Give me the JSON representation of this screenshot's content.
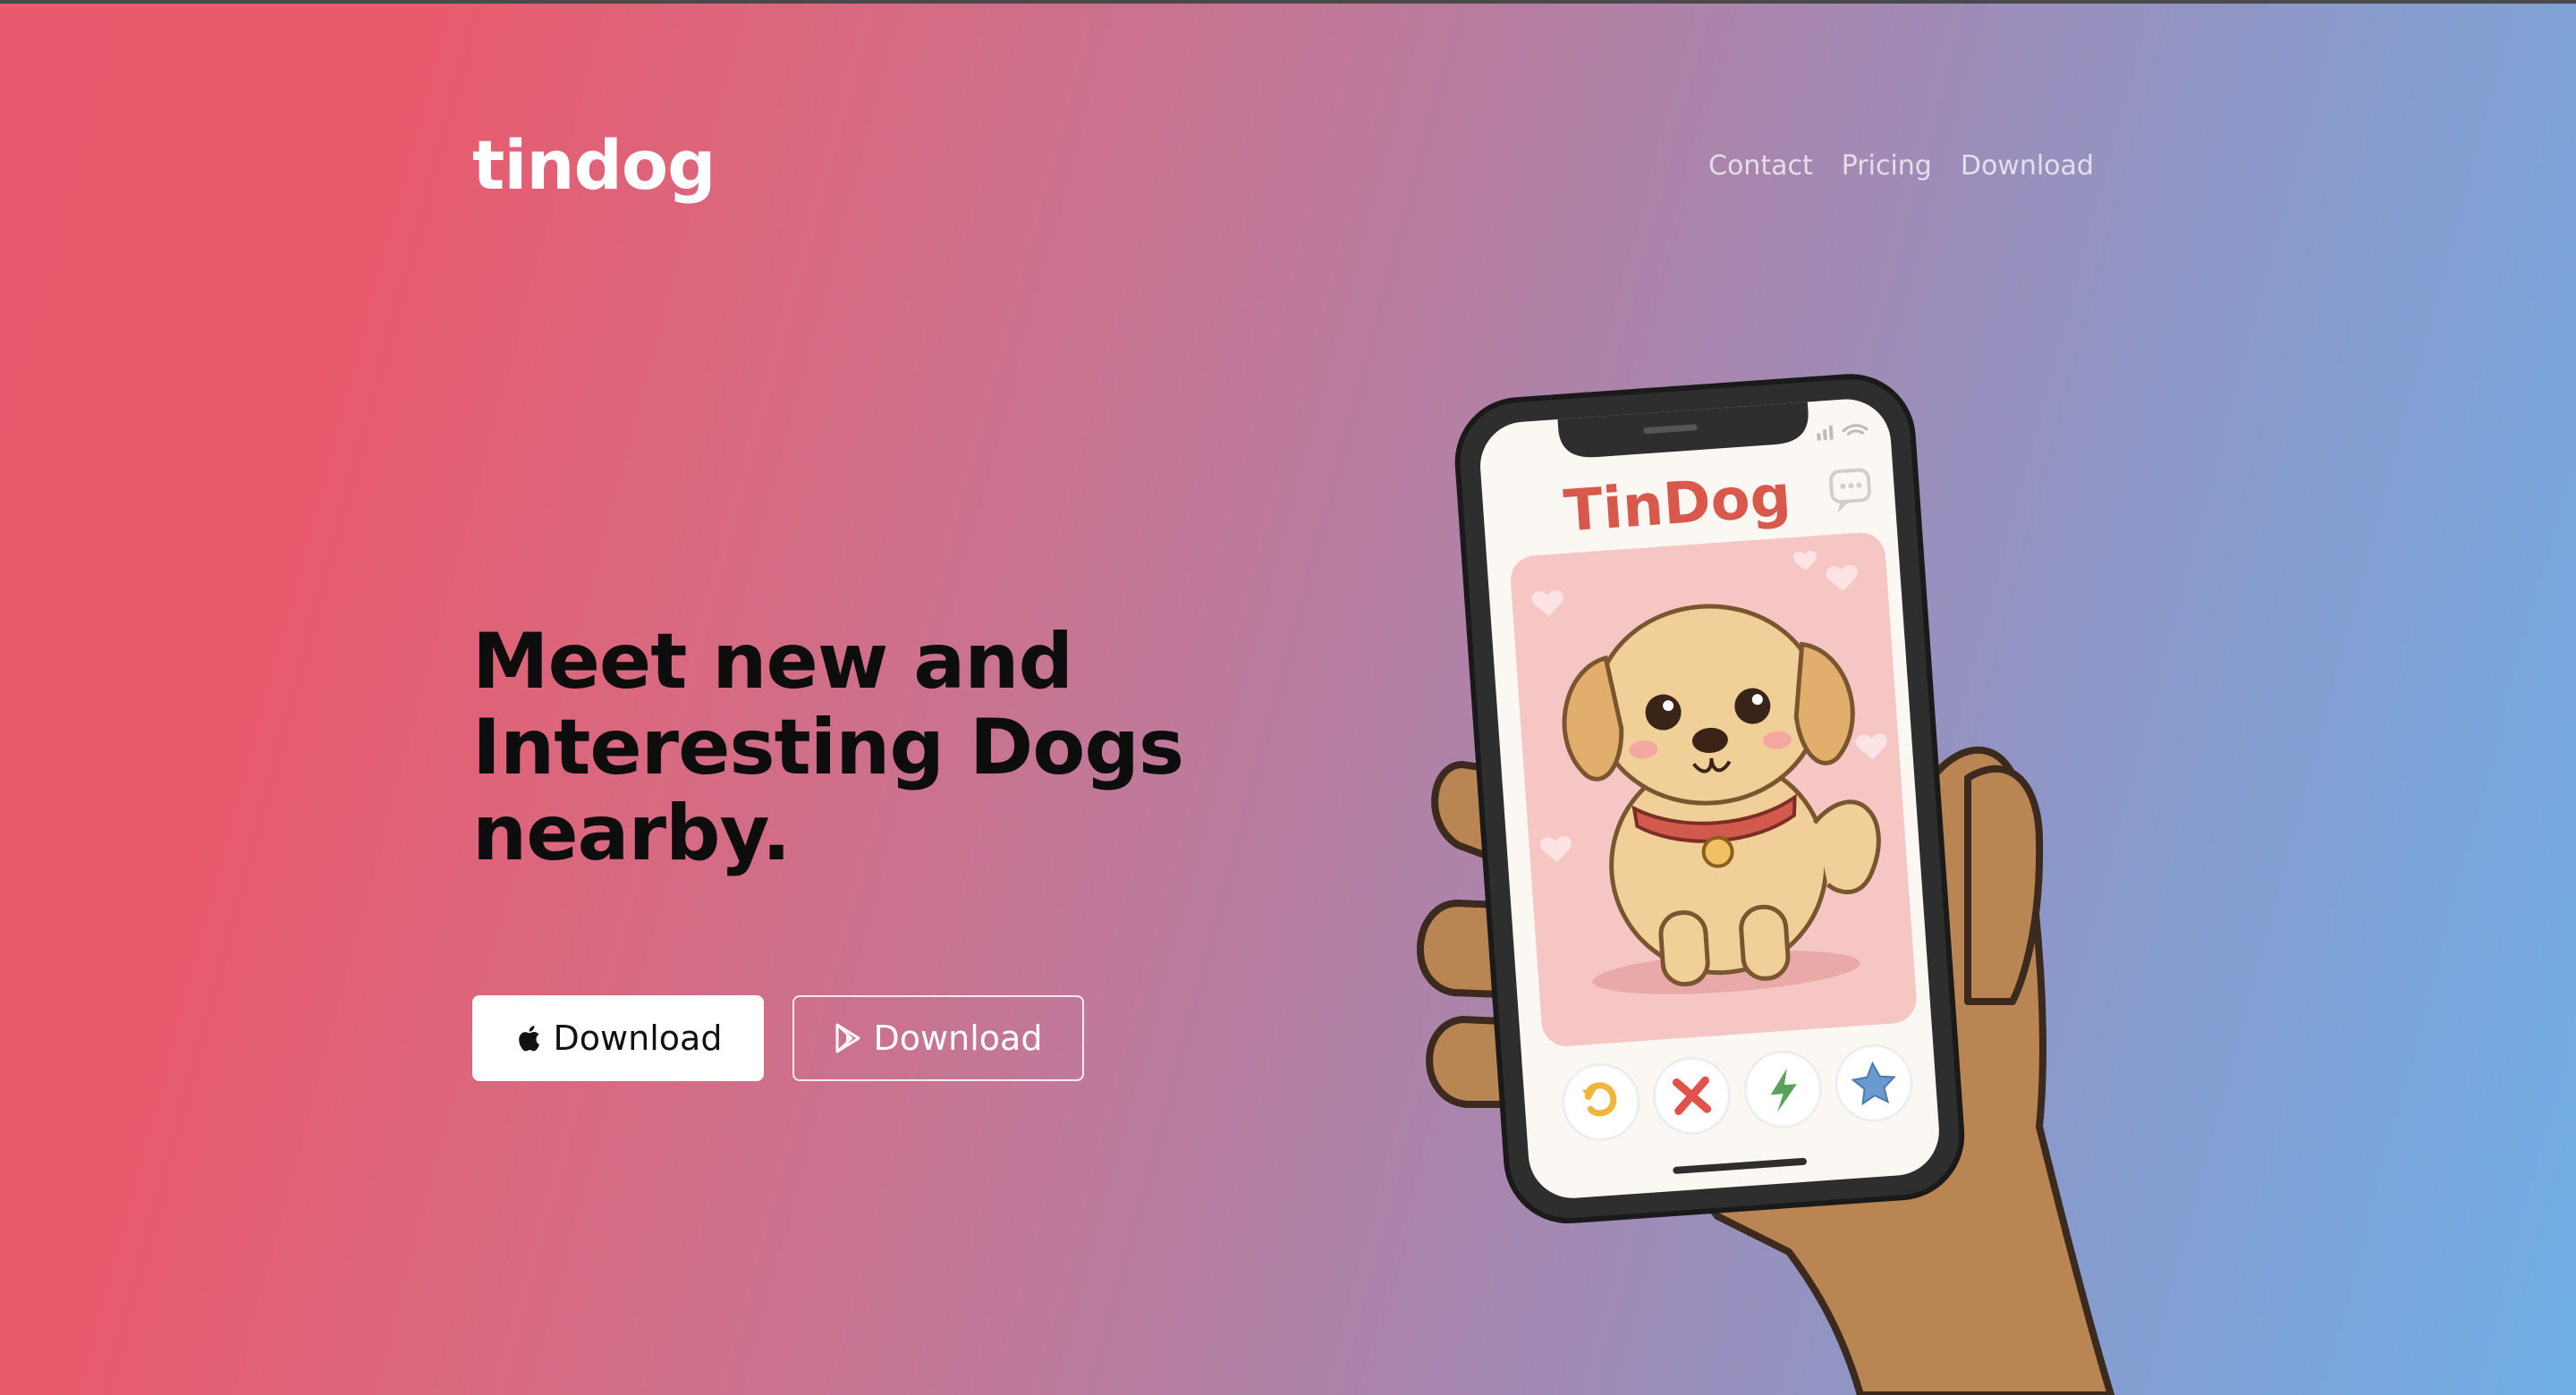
{
  "brand": {
    "name": "tindog"
  },
  "nav": {
    "items": [
      {
        "label": "Contact"
      },
      {
        "label": "Pricing"
      },
      {
        "label": "Download"
      }
    ]
  },
  "hero": {
    "headline_lines": [
      "Meet new and",
      "Interesting Dogs",
      "nearby."
    ],
    "buttons": {
      "apple_label": "Download",
      "play_label": "Download"
    }
  },
  "phone_screen": {
    "app_title": "TinDog"
  },
  "colors": {
    "gradient_start": "#ea5a6e",
    "gradient_end": "#6faee6",
    "headline": "#0d0d0d",
    "app_title": "#d8584c"
  },
  "icons": [
    "apple-icon",
    "google-play-icon",
    "chat-bubble-icon",
    "undo-icon",
    "close-x-icon",
    "lightning-icon",
    "star-icon",
    "signal-icon",
    "wifi-icon"
  ]
}
